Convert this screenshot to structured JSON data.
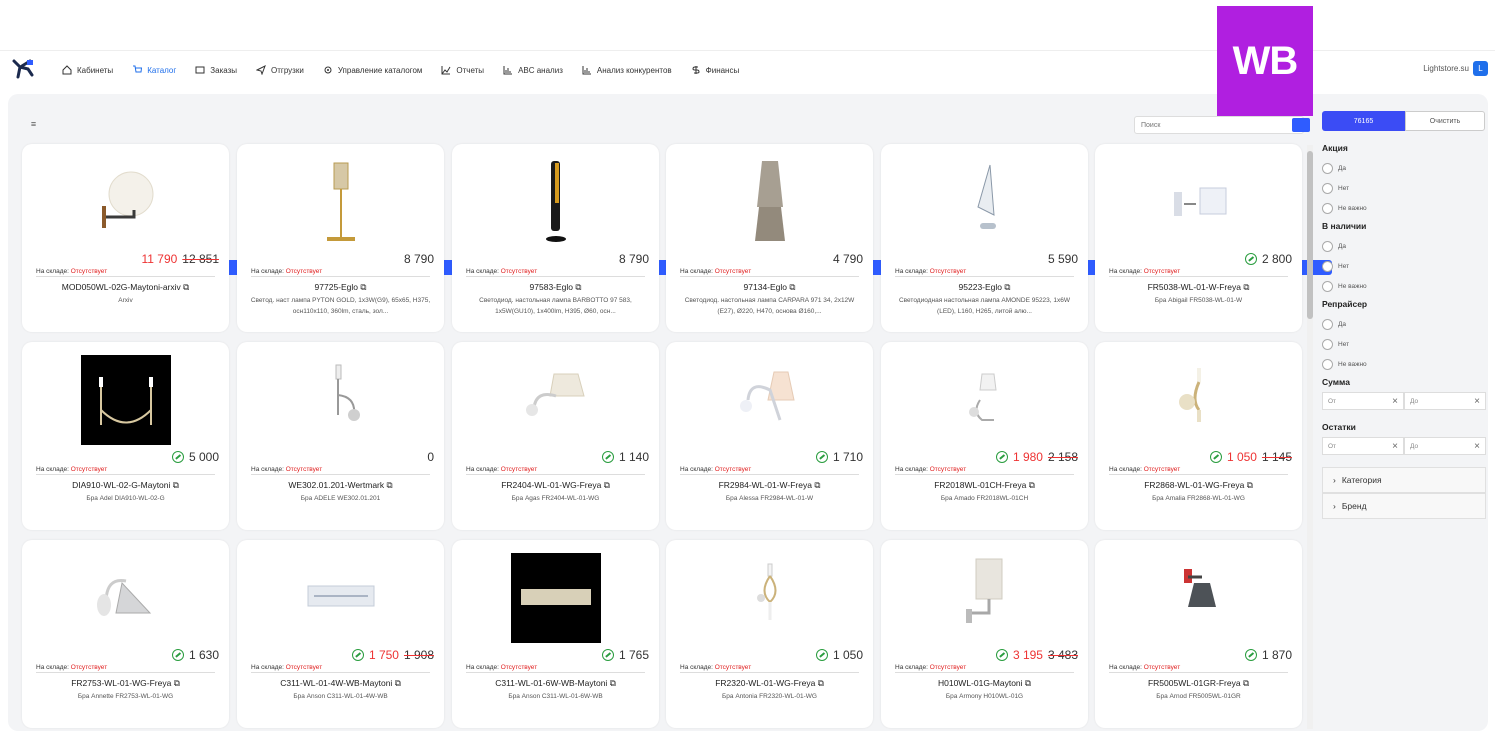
{
  "nav": {
    "items": [
      {
        "label": "Кабинеты",
        "icon": "home-icon",
        "active": false
      },
      {
        "label": "Каталог",
        "icon": "cart-icon",
        "active": true
      },
      {
        "label": "Заказы",
        "icon": "orders-icon",
        "active": false
      },
      {
        "label": "Отгрузки",
        "icon": "send-icon",
        "active": false
      },
      {
        "label": "Управление каталогом",
        "icon": "gear-icon",
        "active": false
      },
      {
        "label": "Отчеты",
        "icon": "chart-line-icon",
        "active": false
      },
      {
        "label": "ABC анализ",
        "icon": "chart-bar-icon",
        "active": false
      },
      {
        "label": "Анализ конкурентов",
        "icon": "chart-bar-icon",
        "active": false
      },
      {
        "label": "Финансы",
        "icon": "dollar-icon",
        "active": false
      }
    ],
    "account": "Lightstore.su",
    "avatar": "L"
  },
  "wb_badge": "WB",
  "toolbar": {
    "search_placeholder": "Поиск",
    "apply_label": "76165",
    "clear_label": "Очистить"
  },
  "stock_label": "На складе:",
  "stock_status": "Отсутствует",
  "products": [
    {
      "price": "11 790",
      "old": "12 851",
      "leaf": false,
      "red": true,
      "sku": "MOD050WL-02G-Maytoni-arxiv",
      "desc": "Arxiv"
    },
    {
      "price": "8 790",
      "old": "",
      "leaf": false,
      "red": false,
      "sku": "97725-Eglo",
      "desc": "Светод. наст лампа PYTON GOLD, 1x3W(G9), 65x65, H375, осн110x110, 360lm, сталь, зол..."
    },
    {
      "price": "8 790",
      "old": "",
      "leaf": false,
      "red": false,
      "sku": "97583-Eglo",
      "desc": "Светодиод. настольная лампа BARBOTTO 97 583, 1x5W(GU10), 1x400lm, H395, Ø60, осн..."
    },
    {
      "price": "4 790",
      "old": "",
      "leaf": false,
      "red": false,
      "sku": "97134-Eglo",
      "desc": "Светодиод. настольная лампа CARPARA 971 34, 2x12W (E27), Ø220, H470, основа Ø160,..."
    },
    {
      "price": "5 590",
      "old": "",
      "leaf": false,
      "red": false,
      "sku": "95223-Eglo",
      "desc": "Светодиодная настольная лампа AMONDE 95223, 1x6W (LED), L160, H265, литой алю..."
    },
    {
      "price": "2 800",
      "old": "",
      "leaf": true,
      "red": false,
      "sku": "FR5038-WL-01-W-Freya",
      "desc": "Бра Abigail FR5038-WL-01-W"
    },
    {
      "price": "5 000",
      "old": "",
      "leaf": true,
      "red": false,
      "sku": "DIA910-WL-02-G-Maytoni",
      "desc": "Бра Adel DIA910-WL-02-G"
    },
    {
      "price": "0",
      "old": "",
      "leaf": false,
      "red": false,
      "sku": "WE302.01.201-Wertmark",
      "desc": "Бра ADELE WE302.01.201"
    },
    {
      "price": "1 140",
      "old": "",
      "leaf": true,
      "red": false,
      "sku": "FR2404-WL-01-WG-Freya",
      "desc": "Бра Agas FR2404-WL-01-WG"
    },
    {
      "price": "1 710",
      "old": "",
      "leaf": true,
      "red": false,
      "sku": "FR2984-WL-01-W-Freya",
      "desc": "Бра Alessa FR2984-WL-01-W"
    },
    {
      "price": "1 980",
      "old": "2 158",
      "leaf": true,
      "red": true,
      "sku": "FR2018WL-01CH-Freya",
      "desc": "Бра Amado FR2018WL-01CH"
    },
    {
      "price": "1 050",
      "old": "1 145",
      "leaf": true,
      "red": true,
      "sku": "FR2868-WL-01-WG-Freya",
      "desc": "Бра Amalia FR2868-WL-01-WG"
    },
    {
      "price": "1 630",
      "old": "",
      "leaf": true,
      "red": false,
      "sku": "FR2753-WL-01-WG-Freya",
      "desc": "Бра Annette FR2753-WL-01-WG"
    },
    {
      "price": "1 750",
      "old": "1 908",
      "leaf": true,
      "red": true,
      "sku": "C311-WL-01-4W-WB-Maytoni",
      "desc": "Бра Anson C311-WL-01-4W-WB"
    },
    {
      "price": "1 765",
      "old": "",
      "leaf": true,
      "red": false,
      "sku": "C311-WL-01-6W-WB-Maytoni",
      "desc": "Бра Anson C311-WL-01-6W-WB"
    },
    {
      "price": "1 050",
      "old": "",
      "leaf": true,
      "red": false,
      "sku": "FR2320-WL-01-WG-Freya",
      "desc": "Бра Antonia FR2320-WL-01-WG"
    },
    {
      "price": "3 195",
      "old": "3 483",
      "leaf": true,
      "red": true,
      "sku": "H010WL-01G-Maytoni",
      "desc": "Бра Armony H010WL-01G"
    },
    {
      "price": "1 870",
      "old": "",
      "leaf": true,
      "red": false,
      "sku": "FR5005WL-01GR-Freya",
      "desc": "Бра Arnod FR5005WL-01GR"
    }
  ],
  "filters": {
    "promo": {
      "title": "Акция",
      "options": [
        "Да",
        "Нет",
        "Не важно"
      ]
    },
    "stock": {
      "title": "В наличии",
      "options": [
        "Да",
        "Нет",
        "Не важно"
      ]
    },
    "repricer": {
      "title": "Репрайсер",
      "options": [
        "Да",
        "Нет",
        "Не важно"
      ]
    },
    "sum": {
      "title": "Сумма",
      "from": "От",
      "to": "До"
    },
    "remains": {
      "title": "Остатки",
      "from": "От",
      "to": "До"
    },
    "category": "Категория",
    "brand": "Бренд"
  }
}
